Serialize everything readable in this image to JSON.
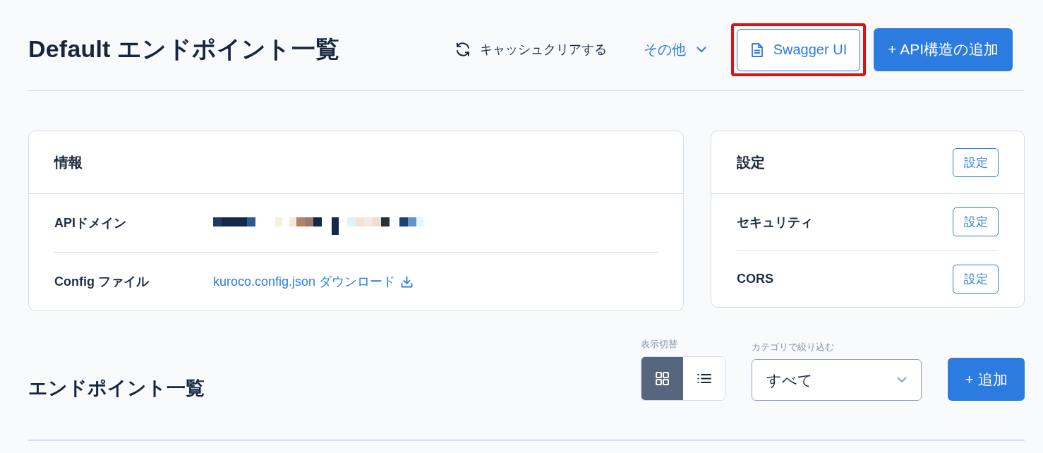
{
  "header": {
    "title": "Default エンドポイント一覧",
    "actions": [
      {
        "kind": "refresh",
        "label": "キャッシュクリアする",
        "highlighted": false
      },
      {
        "kind": "menu",
        "label": "その他",
        "highlighted": false
      },
      {
        "kind": "document",
        "label": "Swagger UI",
        "highlighted": true
      },
      {
        "kind": "primary",
        "label": "+ API構造の追加",
        "highlighted": false
      }
    ]
  },
  "info_card": {
    "title": "情報",
    "rows": [
      {
        "kind": "redacted",
        "label": "APIドメイン"
      },
      {
        "kind": "download",
        "label": "Config ファイル",
        "value": "kuroco.config.json ダウンロード"
      }
    ]
  },
  "settings_card": {
    "title": "設定",
    "button": "設定",
    "rows": [
      {
        "label": "セキュリティ",
        "button": "設定"
      },
      {
        "label": "CORS",
        "button": "設定"
      }
    ]
  },
  "endpoints": {
    "title": "エンドポイント一覧",
    "view_toggle": {
      "label": "表示切替",
      "options": [
        {
          "kind": "grid",
          "selected": true
        },
        {
          "kind": "list",
          "selected": false
        }
      ]
    },
    "category_filter": {
      "label": "カテゴリで絞り込む",
      "value": "すべて"
    },
    "add_button": "+ 追加"
  }
}
